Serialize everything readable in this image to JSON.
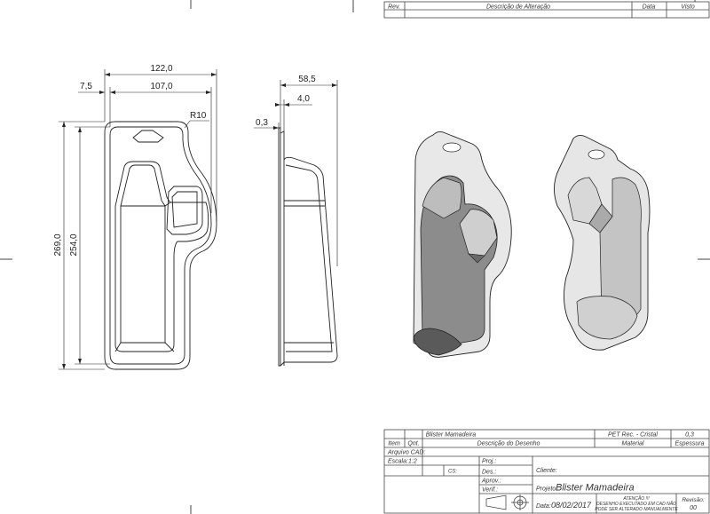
{
  "revision_block": {
    "headers": [
      "Rev.",
      "Descrição de Alteração",
      "Data",
      "Visto"
    ]
  },
  "dimensions": {
    "overall_width": "122,0",
    "inner_width": "107,0",
    "offset": "7,5",
    "corner_radius": "R10",
    "overall_height": "269,0",
    "inner_height": "254,0",
    "depth": "58,5",
    "flange": "4,0",
    "thickness": "0,3"
  },
  "title_block": {
    "item_row": {
      "item": "",
      "qty": "",
      "description": "Blister Mamadeira",
      "material": "PET Rec. - Cristal",
      "thickness": "0,3"
    },
    "header_row": {
      "item": "Item",
      "qty": "Qnt.",
      "description": "Descrição do Desenho",
      "material": "Material",
      "thickness": "Espessura"
    },
    "arquivo_cad_label": "Arquivo CAD:",
    "escala_label": "Escala:",
    "escala_value": "1:2",
    "cs_label": "CS:",
    "proj_label": "Proj.:",
    "des_label": "Des.:",
    "aprov_label": "Aprov.:",
    "verif_label": "Verif.:",
    "cliente_label": "Cliente:",
    "projeto_label": "Projeto:",
    "projeto_value": "Blister Mamadeira",
    "data_label": "Data:",
    "data_value": "08/02/2017",
    "attention_title": "ATENÇÃO !!!",
    "attention_line1": "DESENHO EXECUTADO EM CAD NÃO",
    "attention_line2": "PODE SER ALTERADO MANUALMENTE",
    "revisao_label": "Revisão:",
    "revisao_value": "00"
  }
}
